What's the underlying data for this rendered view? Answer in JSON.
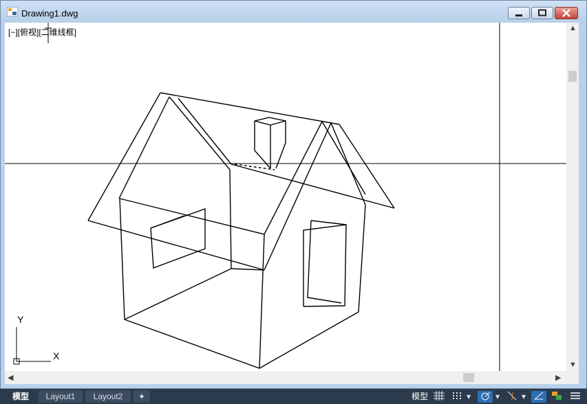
{
  "window": {
    "title": "Drawing1.dwg"
  },
  "viewport": {
    "label": "[−][俯视][二维线框]"
  },
  "ucs": {
    "x_label": "X",
    "y_label": "Y"
  },
  "tabs": [
    "模型",
    "Layout1",
    "Layout2",
    "+"
  ],
  "status": {
    "model_label": "模型"
  },
  "icons": {
    "app": "autocad-drawing-icon",
    "minimize": "minimize-icon",
    "maximize": "maximize-icon",
    "close": "close-icon",
    "grid": "grid-icon",
    "snap": "snap-icon",
    "polar": "polar-tracking-icon",
    "osnap": "object-snap-icon",
    "isodraft": "isometric-icon",
    "annotation": "annotation-icon",
    "menu": "hamburger-menu-icon"
  },
  "colors": {
    "active_toggle": "#2c6fb5",
    "statusbar": "#2b3a4c"
  }
}
